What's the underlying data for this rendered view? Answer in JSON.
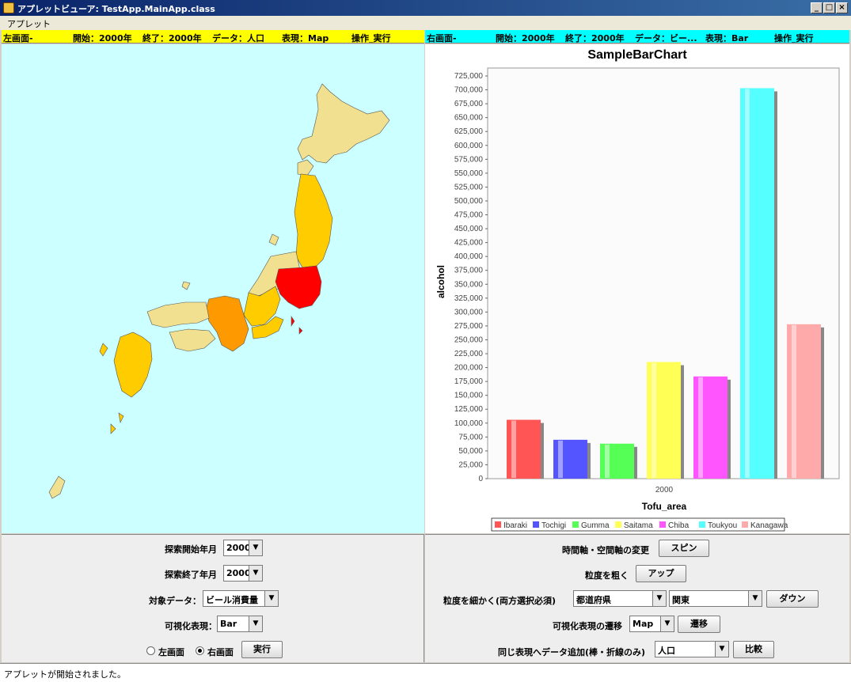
{
  "window": {
    "title": "アプレットビューア: TestApp.MainApp.class",
    "min": "_",
    "max": "□",
    "close": "×"
  },
  "menu": {
    "applet": "アプレット"
  },
  "left_info": {
    "screen": "左画面-",
    "start": "開始：2000年",
    "end": "終了：2000年",
    "data": "データ：人口",
    "repr": "表現：Map",
    "op": "操作_実行"
  },
  "right_info": {
    "screen": "右画面-",
    "start": "開始：2000年",
    "end": "終了：2000年",
    "data": "データ：ビー...",
    "repr": "表現：Bar",
    "op": "操作_実行"
  },
  "colors": {
    "map_bg": "#ccffff",
    "high": "#ff0000",
    "upper": "#ff9900",
    "mid": "#ffcc00",
    "low": "#f0e090"
  },
  "chart_data": {
    "type": "bar",
    "title": "SampleBarChart",
    "xlabel": "Tofu_area",
    "ylabel": "alcohol",
    "categories": [
      "2000"
    ],
    "ylim": [
      0,
      725000
    ],
    "y_ticks": [
      "0",
      "25,000",
      "50,000",
      "75,000",
      "100,000",
      "125,000",
      "150,000",
      "175,000",
      "200,000",
      "225,000",
      "250,000",
      "275,000",
      "300,000",
      "325,000",
      "350,000",
      "375,000",
      "400,000",
      "425,000",
      "450,000",
      "475,000",
      "500,000",
      "525,000",
      "550,000",
      "575,000",
      "600,000",
      "625,000",
      "650,000",
      "675,000",
      "700,000",
      "725,000"
    ],
    "legend_position": "bottom",
    "series": [
      {
        "name": "Ibaraki",
        "values": [
          106000
        ],
        "color": "#ff5555"
      },
      {
        "name": "Tochigi",
        "values": [
          70000
        ],
        "color": "#5555ff"
      },
      {
        "name": "Gumma",
        "values": [
          63000
        ],
        "color": "#55ff55"
      },
      {
        "name": "Saitama",
        "values": [
          210000
        ],
        "color": "#ffff55"
      },
      {
        "name": "Chiba",
        "values": [
          184000
        ],
        "color": "#ff55ff"
      },
      {
        "name": "Toukyou",
        "values": [
          703000
        ],
        "color": "#55ffff"
      },
      {
        "name": "Kanagawa",
        "values": [
          278000
        ],
        "color": "#ffaaaa"
      }
    ]
  },
  "controls_left": {
    "start_label": "探索開始年月",
    "start_value": "2000",
    "end_label": "探索終了年月",
    "end_value": "2000",
    "data_label": "対象データ：",
    "data_value": "ビール消費量",
    "repr_label": "可視化表現：",
    "repr_value": "Bar",
    "radio_left": "左画面",
    "radio_right": "右画面",
    "run_button": "実行"
  },
  "controls_right": {
    "spin_label": "時間軸・空間軸の変更",
    "spin_button": "スピン",
    "coarse_label": "粒度を粗く",
    "up_button": "アップ",
    "fine_label": "粒度を細かく(両方選択必須)",
    "fine_value1": "都道府県",
    "fine_value2": "関東",
    "down_button": "ダウン",
    "trans_label": "可視化表現の遷移",
    "trans_value": "Map",
    "trans_button": "遷移",
    "add_label": "同じ表現へデータ追加(棒・折線のみ)",
    "add_value": "人口",
    "compare_button": "比較"
  },
  "status": "アプレットが開始されました。"
}
